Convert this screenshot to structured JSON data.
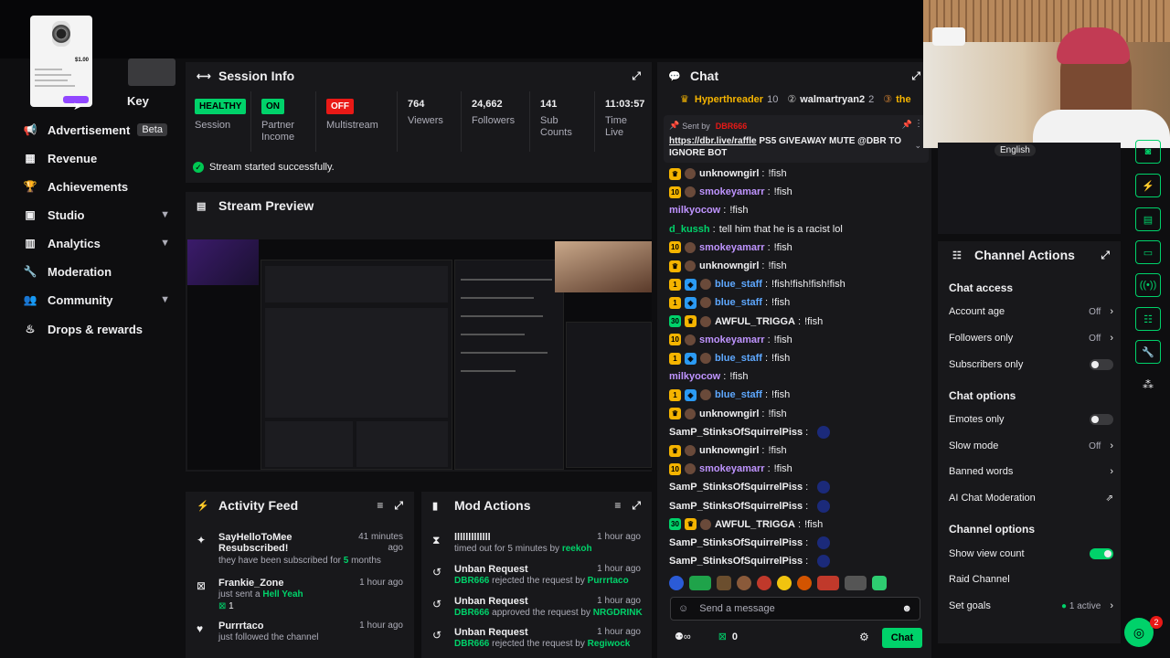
{
  "overlay_card": {
    "price": "$1.00"
  },
  "sidebar": {
    "key_label": "Key",
    "items": [
      {
        "label": "Advertisement",
        "badge": "Beta",
        "icon": "megaphone-icon"
      },
      {
        "label": "Revenue",
        "icon": "chart-icon"
      },
      {
        "label": "Achievements",
        "icon": "trophy-icon"
      },
      {
        "label": "Studio",
        "icon": "studio-icon"
      },
      {
        "label": "Analytics",
        "icon": "analytics-icon"
      },
      {
        "label": "Moderation",
        "icon": "wrench-icon"
      },
      {
        "label": "Community",
        "icon": "people-icon"
      },
      {
        "label": "Drops & rewards",
        "icon": "drops-icon"
      }
    ]
  },
  "session": {
    "title": "Session Info",
    "stats": [
      {
        "badge": "HEALTHY",
        "label": "Session",
        "badge_color": "#00d26a"
      },
      {
        "badge": "ON",
        "label": "Partner Income",
        "badge_color": "#00d26a"
      },
      {
        "badge": "OFF",
        "label": "Multistream",
        "badge_color": "#e91916"
      },
      {
        "value": "764",
        "label": "Viewers"
      },
      {
        "value": "24,662",
        "label": "Followers"
      },
      {
        "value": "141",
        "label": "Sub Counts"
      },
      {
        "value": "11:03:57",
        "label": "Time Live"
      }
    ],
    "status": "Stream started successfully."
  },
  "preview": {
    "title": "Stream Preview"
  },
  "activity": {
    "title": "Activity Feed",
    "items": [
      {
        "name": "SayHelloToMee Resubscribed!",
        "sub_a": "they have been subscribed for ",
        "sub_hl": "5",
        "sub_b": " months",
        "time": "41 minutes ago"
      },
      {
        "name": "Frankie_Zone",
        "sub_a": "just sent a ",
        "sub_hl": "Hell Yeah",
        "sub_b": "",
        "count": "1",
        "time": "1 hour ago"
      },
      {
        "name": "Purrrtaco",
        "sub_a": "just followed the channel",
        "sub_hl": "",
        "sub_b": "",
        "time": "1 hour ago"
      }
    ]
  },
  "mod": {
    "title": "Mod Actions",
    "items": [
      {
        "title": "lllllllllllll",
        "by_a": "timed out for 5 minutes by ",
        "by_user": "reekoh",
        "by_b": "",
        "time": "1 hour ago"
      },
      {
        "title": "Unban Request",
        "by_user0": "DBR666",
        "by_a": " rejected the request by ",
        "by_user": "Purrrtaco",
        "time": "1 hour ago"
      },
      {
        "title": "Unban Request",
        "by_user0": "DBR666",
        "by_a": " approved the request by ",
        "by_user": "NRGDRINK",
        "time": "1 hour ago"
      },
      {
        "title": "Unban Request",
        "by_user0": "DBR666",
        "by_a": " rejected the request by ",
        "by_user": "Regiwock",
        "time": "1 hour ago"
      }
    ]
  },
  "chat": {
    "title": "Chat",
    "leaders": [
      {
        "name": "Hyperthreader",
        "count": "10"
      },
      {
        "name": "walmartryan2",
        "count": "2"
      },
      {
        "name": "the",
        "count": ""
      }
    ],
    "pinned": {
      "sent_by": "Sent by",
      "user": "DBR666",
      "link": "https://dbr.live/raffle",
      "text": " PS5 GIVEAWAY MUTE @DBR TO IGNORE BOT"
    },
    "messages": [
      {
        "user": "unknowngirl",
        "text": "!fish",
        "color": "#efeff1",
        "badges": [
          "crown"
        ]
      },
      {
        "user": "smokeyamarr",
        "text": "!fish",
        "color": "#bf94ff",
        "badges": [
          "10"
        ]
      },
      {
        "user": "milkyocow",
        "text": "!fish",
        "color": "#bf94ff",
        "badges": []
      },
      {
        "user": "d_kussh",
        "text": "tell him that he is a racist lol",
        "color": "#00d26a",
        "badges": []
      },
      {
        "user": "smokeyamarr",
        "text": "!fish",
        "color": "#bf94ff",
        "badges": [
          "10"
        ]
      },
      {
        "user": "unknowngirl",
        "text": "!fish",
        "color": "#efeff1",
        "badges": [
          "crown"
        ]
      },
      {
        "user": "blue_staff",
        "text": "!fish!fish!fish!fish",
        "color": "#5ea8ff",
        "badges": [
          "1",
          "prime"
        ]
      },
      {
        "user": "blue_staff",
        "text": "!fish",
        "color": "#5ea8ff",
        "badges": [
          "1",
          "prime"
        ]
      },
      {
        "user": "AWFUL_TRIGGA",
        "text": "!fish",
        "color": "#efeff1",
        "badges": [
          "30",
          "crown"
        ]
      },
      {
        "user": "smokeyamarr",
        "text": "!fish",
        "color": "#bf94ff",
        "badges": [
          "10"
        ]
      },
      {
        "user": "blue_staff",
        "text": "!fish",
        "color": "#5ea8ff",
        "badges": [
          "1",
          "prime"
        ]
      },
      {
        "user": "milkyocow",
        "text": "!fish",
        "color": "#bf94ff",
        "badges": []
      },
      {
        "user": "blue_staff",
        "text": "!fish",
        "color": "#5ea8ff",
        "badges": [
          "1",
          "prime"
        ]
      },
      {
        "user": "unknowngirl",
        "text": "!fish",
        "color": "#efeff1",
        "badges": [
          "crown"
        ]
      },
      {
        "user": "SamP_StinksOfSquirrelPiss",
        "text": "",
        "color": "#efeff1",
        "badges": []
      },
      {
        "user": "unknowngirl",
        "text": "!fish",
        "color": "#efeff1",
        "badges": [
          "crown"
        ]
      },
      {
        "user": "smokeyamarr",
        "text": "!fish",
        "color": "#bf94ff",
        "badges": [
          "10"
        ]
      },
      {
        "user": "SamP_StinksOfSquirrelPiss",
        "text": "",
        "color": "#efeff1",
        "badges": []
      },
      {
        "user": "SamP_StinksOfSquirrelPiss",
        "text": "",
        "color": "#efeff1",
        "badges": []
      },
      {
        "user": "AWFUL_TRIGGA",
        "text": "!fish",
        "color": "#efeff1",
        "badges": [
          "30",
          "crown"
        ]
      },
      {
        "user": "SamP_StinksOfSquirrelPiss",
        "text": "",
        "color": "#efeff1",
        "badges": []
      },
      {
        "user": "SamP_StinksOfSquirrelPiss",
        "text": "",
        "color": "#efeff1",
        "badges": []
      }
    ],
    "placeholder": "Send a message",
    "points": "0",
    "chat_button": "Chat"
  },
  "webcam": {
    "language": "English"
  },
  "channel_actions": {
    "title": "Channel Actions",
    "chat_access": "Chat access",
    "account_age": {
      "label": "Account age",
      "value": "Off"
    },
    "followers_only": {
      "label": "Followers only",
      "value": "Off"
    },
    "subscribers_only": {
      "label": "Subscribers only"
    },
    "chat_options": "Chat options",
    "emotes_only": {
      "label": "Emotes only"
    },
    "slow_mode": {
      "label": "Slow mode",
      "value": "Off"
    },
    "banned_words": {
      "label": "Banned words"
    },
    "ai_mod": {
      "label": "AI Chat Moderation"
    },
    "channel_options": "Channel options",
    "show_view_count": {
      "label": "Show view count"
    },
    "raid_channel": {
      "label": "Raid Channel"
    },
    "set_goals": {
      "label": "Set goals",
      "value": "1 active"
    }
  },
  "help": {
    "count": "2"
  },
  "colors": {
    "accent": "#00d26a",
    "offline": "#e91916",
    "username_purple": "#bf94ff",
    "username_blue": "#5ea8ff"
  }
}
